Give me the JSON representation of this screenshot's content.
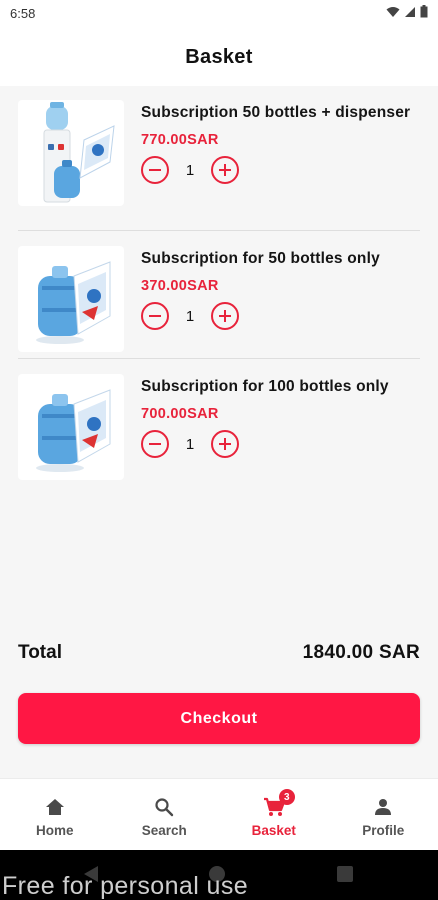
{
  "status_bar": {
    "time": "6:58"
  },
  "header": {
    "title": "Basket"
  },
  "items": [
    {
      "name": "Subscription 50 bottles + dispenser",
      "price": "770.00SAR",
      "quantity": "1",
      "image": "water-dispenser-with-bottle"
    },
    {
      "name": "Subscription for 50 bottles only",
      "price": "370.00SAR",
      "quantity": "1",
      "image": "water-bottle"
    },
    {
      "name": "Subscription for 100 bottles only",
      "price": "700.00SAR",
      "quantity": "1",
      "image": "water-bottle"
    }
  ],
  "total": {
    "label": "Total",
    "value": "1840.00 SAR"
  },
  "checkout": {
    "label": "Checkout"
  },
  "nav": {
    "items": [
      {
        "label": "Home",
        "icon": "home-icon"
      },
      {
        "label": "Search",
        "icon": "search-icon"
      },
      {
        "label": "Basket",
        "icon": "cart-icon",
        "badge": "3",
        "active": true
      },
      {
        "label": "Profile",
        "icon": "person-icon"
      }
    ]
  },
  "watermark": "Free for personal use",
  "colors": {
    "accent": "#ff1744",
    "price": "#e8233b",
    "background": "#f6f6f6"
  }
}
